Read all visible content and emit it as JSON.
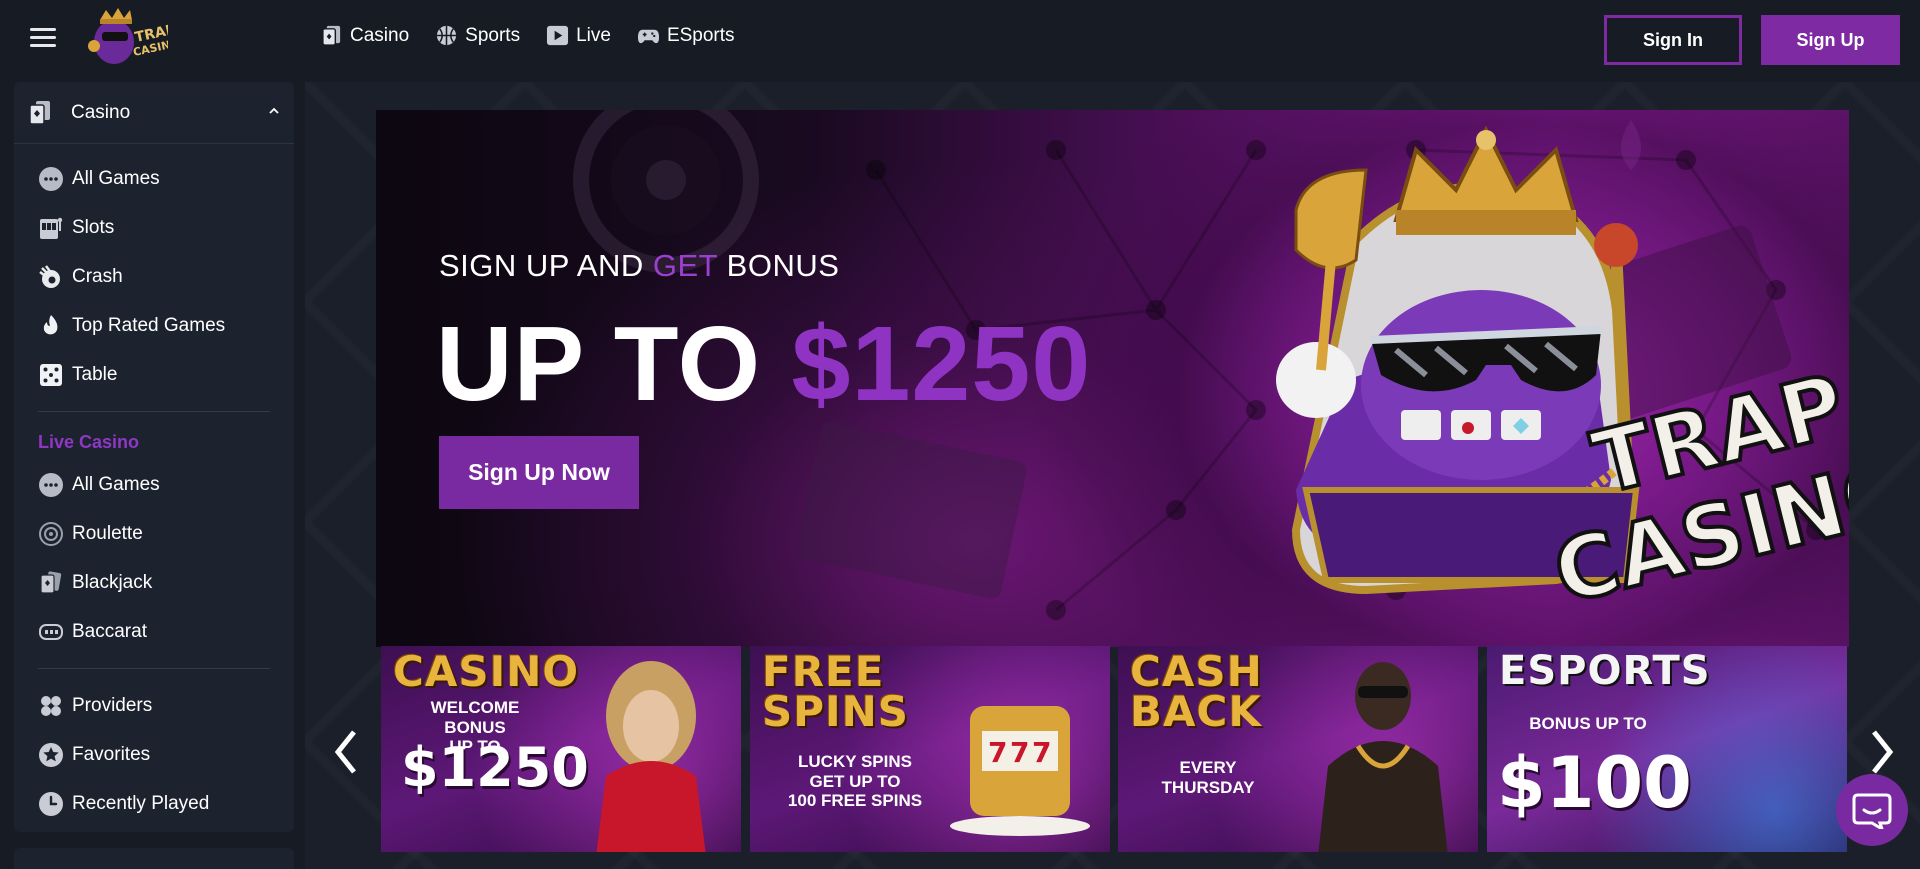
{
  "header": {
    "menu_icon": "hamburger-icon",
    "logo_text": "TRAP CASINO",
    "nav": [
      {
        "label": "Casino",
        "icon": "casino-card-icon"
      },
      {
        "label": "Sports",
        "icon": "basketball-icon"
      },
      {
        "label": "Live",
        "icon": "play-icon"
      },
      {
        "label": "ESports",
        "icon": "gamepad-icon"
      }
    ],
    "sign_in": "Sign In",
    "sign_up": "Sign Up"
  },
  "sidebar": {
    "section_title": "Casino",
    "casino_items": [
      {
        "label": "All Games",
        "icon": "all-games-icon"
      },
      {
        "label": "Slots",
        "icon": "slot-machine-icon"
      },
      {
        "label": "Crash",
        "icon": "crash-icon"
      },
      {
        "label": "Top Rated Games",
        "icon": "fire-icon"
      },
      {
        "label": "Table",
        "icon": "dice-icon"
      }
    ],
    "live_title": "Live Casino",
    "live_items": [
      {
        "label": "All Games",
        "icon": "all-games-icon"
      },
      {
        "label": "Roulette",
        "icon": "roulette-icon"
      },
      {
        "label": "Blackjack",
        "icon": "cards-icon"
      },
      {
        "label": "Baccarat",
        "icon": "baccarat-icon"
      }
    ],
    "extra_items": [
      {
        "label": "Providers",
        "icon": "providers-icon"
      },
      {
        "label": "Favorites",
        "icon": "star-icon"
      },
      {
        "label": "Recently Played",
        "icon": "clock-icon"
      }
    ]
  },
  "hero": {
    "sub_prefix": "SIGN UP AND ",
    "sub_accent": "GET",
    "sub_suffix": " BONUS",
    "big_prefix": "UP TO ",
    "big_accent": "$1250",
    "cta": "Sign Up Now",
    "brand_line1": "TRAP",
    "brand_line2": "CASINO"
  },
  "promos": [
    {
      "title": "CASINO",
      "line1": "WELCOME BONUS",
      "line2": "UP TO",
      "amount": "$1250"
    },
    {
      "title_line1": "FREE",
      "title_line2": "SPINS",
      "line1": "LUCKY SPINS",
      "line2": "GET UP TO",
      "line3": "100 FREE SPINS"
    },
    {
      "title_line1": "CASH",
      "title_line2": "BACK",
      "line1": "EVERY",
      "line2": "THURSDAY"
    },
    {
      "title": "ESPORTS",
      "line1": "BONUS UP TO",
      "amount": "$100"
    }
  ],
  "colors": {
    "accent": "#7d2aa3",
    "accent_text": "#8e37c4",
    "background": "#161b24",
    "sidebar": "#1d232e"
  }
}
